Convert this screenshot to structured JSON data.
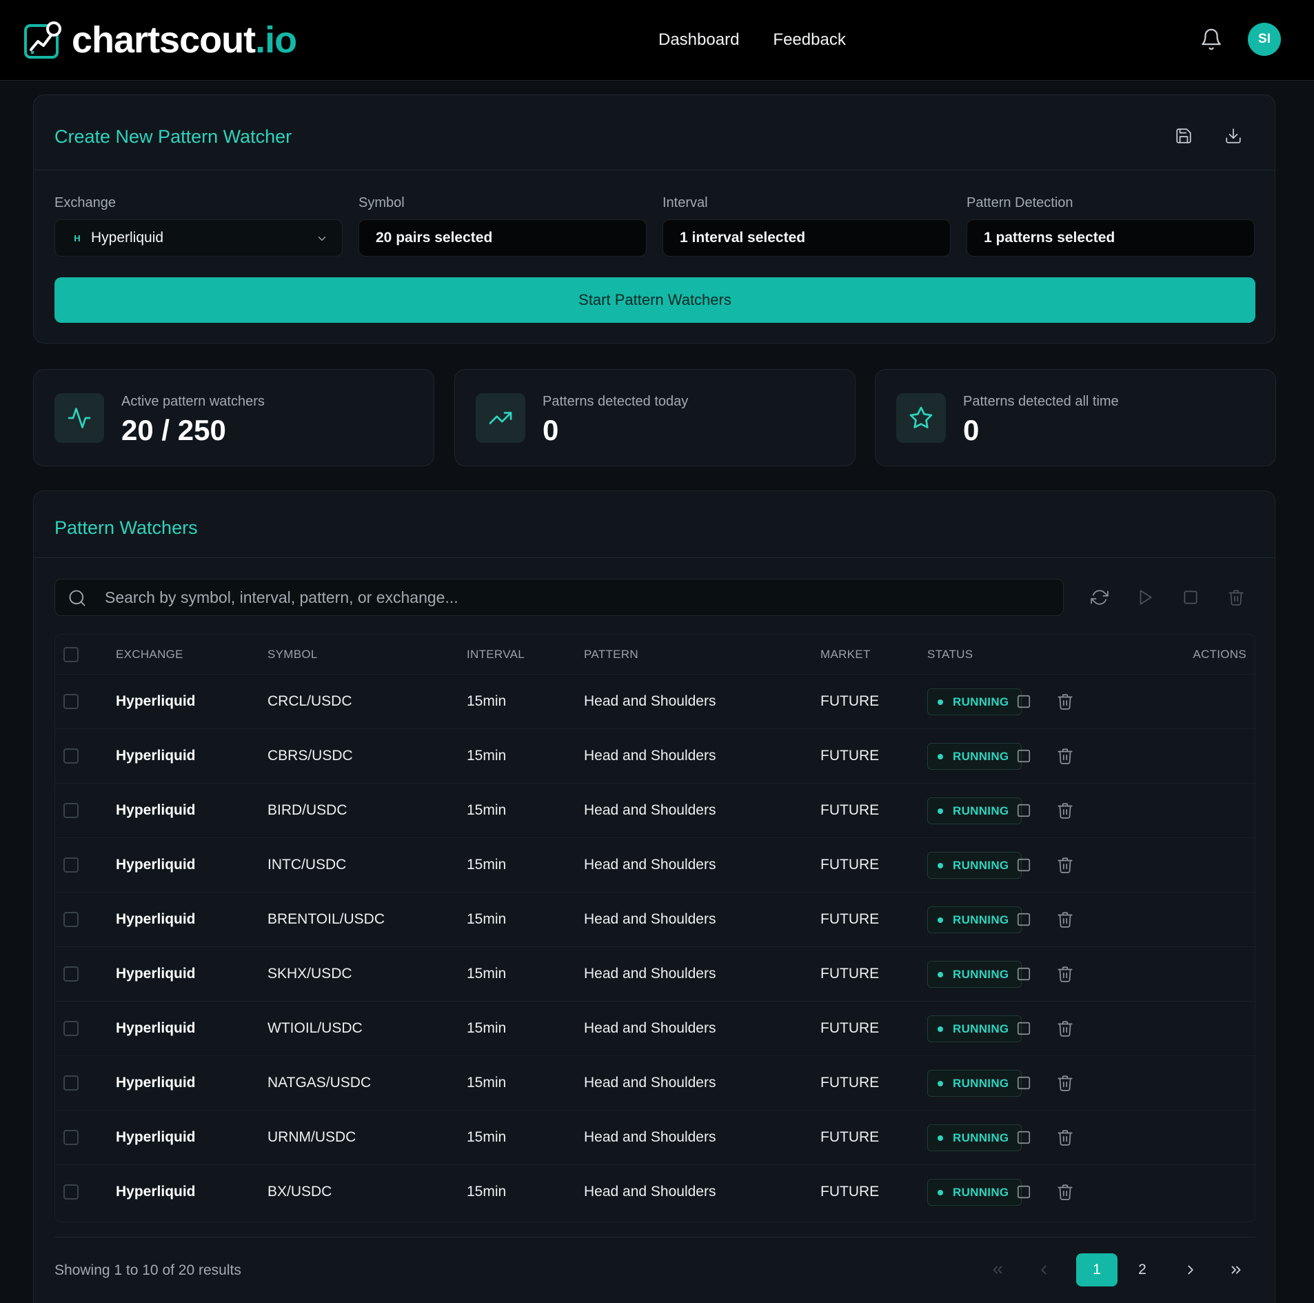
{
  "brand": {
    "name": "chartscout",
    "tld": ".io"
  },
  "nav": {
    "items": [
      "Dashboard",
      "Feedback"
    ]
  },
  "user": {
    "initials": "SI"
  },
  "create": {
    "title": "Create New Pattern Watcher",
    "fields": {
      "exchange": {
        "label": "Exchange",
        "value": "Hyperliquid",
        "badge": "H"
      },
      "symbol": {
        "label": "Symbol",
        "value": "20 pairs selected"
      },
      "interval": {
        "label": "Interval",
        "value": "1 interval selected"
      },
      "pattern": {
        "label": "Pattern Detection",
        "value": "1 patterns selected"
      }
    },
    "start_button": "Start Pattern Watchers"
  },
  "stats": [
    {
      "label": "Active pattern watchers",
      "value": "20 / 250",
      "icon": "activity-icon"
    },
    {
      "label": "Patterns detected today",
      "value": "0",
      "icon": "trending-up-icon"
    },
    {
      "label": "Patterns detected all time",
      "value": "0",
      "icon": "star-icon"
    }
  ],
  "watchers": {
    "title": "Pattern Watchers",
    "search_placeholder": "Search by symbol, interval, pattern, or exchange...",
    "columns": [
      "EXCHANGE",
      "SYMBOL",
      "INTERVAL",
      "PATTERN",
      "MARKET",
      "STATUS",
      "ACTIONS"
    ],
    "rows": [
      {
        "exchange": "Hyperliquid",
        "symbol": "CRCL/USDC",
        "interval": "15min",
        "pattern": "Head and Shoulders",
        "market": "FUTURE",
        "status": "RUNNING"
      },
      {
        "exchange": "Hyperliquid",
        "symbol": "CBRS/USDC",
        "interval": "15min",
        "pattern": "Head and Shoulders",
        "market": "FUTURE",
        "status": "RUNNING"
      },
      {
        "exchange": "Hyperliquid",
        "symbol": "BIRD/USDC",
        "interval": "15min",
        "pattern": "Head and Shoulders",
        "market": "FUTURE",
        "status": "RUNNING"
      },
      {
        "exchange": "Hyperliquid",
        "symbol": "INTC/USDC",
        "interval": "15min",
        "pattern": "Head and Shoulders",
        "market": "FUTURE",
        "status": "RUNNING"
      },
      {
        "exchange": "Hyperliquid",
        "symbol": "BRENTOIL/USDC",
        "interval": "15min",
        "pattern": "Head and Shoulders",
        "market": "FUTURE",
        "status": "RUNNING"
      },
      {
        "exchange": "Hyperliquid",
        "symbol": "SKHX/USDC",
        "interval": "15min",
        "pattern": "Head and Shoulders",
        "market": "FUTURE",
        "status": "RUNNING"
      },
      {
        "exchange": "Hyperliquid",
        "symbol": "WTIOIL/USDC",
        "interval": "15min",
        "pattern": "Head and Shoulders",
        "market": "FUTURE",
        "status": "RUNNING"
      },
      {
        "exchange": "Hyperliquid",
        "symbol": "NATGAS/USDC",
        "interval": "15min",
        "pattern": "Head and Shoulders",
        "market": "FUTURE",
        "status": "RUNNING"
      },
      {
        "exchange": "Hyperliquid",
        "symbol": "URNM/USDC",
        "interval": "15min",
        "pattern": "Head and Shoulders",
        "market": "FUTURE",
        "status": "RUNNING"
      },
      {
        "exchange": "Hyperliquid",
        "symbol": "BX/USDC",
        "interval": "15min",
        "pattern": "Head and Shoulders",
        "market": "FUTURE",
        "status": "RUNNING"
      }
    ],
    "results_text": "Showing 1 to 10 of 20 results",
    "pagination": {
      "pages": [
        "1",
        "2"
      ],
      "current": "1"
    }
  },
  "colors": {
    "accent": "#14b8a6",
    "background": "#0c1014",
    "card": "#10161b"
  }
}
